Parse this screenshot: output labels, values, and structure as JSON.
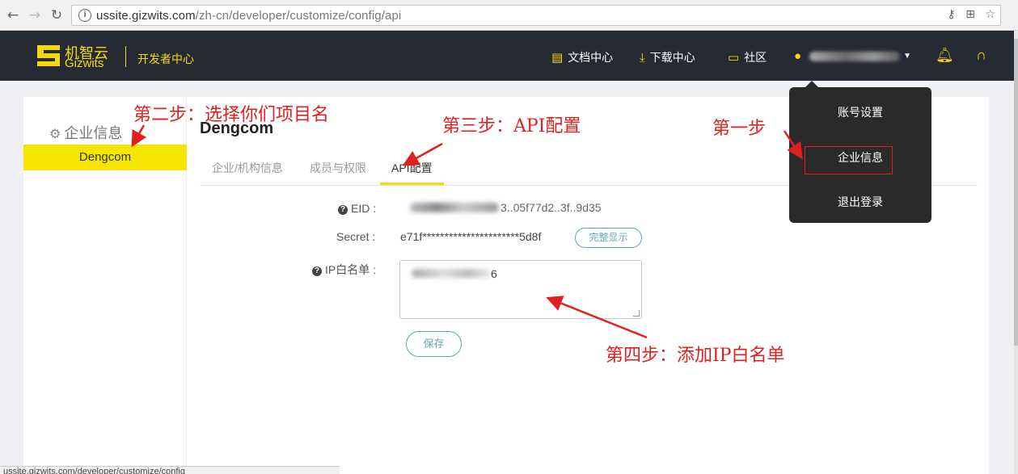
{
  "browser": {
    "url_host": "ussite.gizwits.com",
    "url_path": "/zh-cn/developer/customize/config/api",
    "status_url": "ussite.gizwits.com/developer/customize/config"
  },
  "header": {
    "brand_cn": "机智云",
    "brand_en": "Gizwits",
    "dev_center": "开发者中心",
    "nav": [
      {
        "label": "文档中心",
        "icon": "document-icon"
      },
      {
        "label": "下载中心",
        "icon": "download-icon"
      },
      {
        "label": "社区",
        "icon": "chat-icon"
      }
    ],
    "accent": "#f6d80f",
    "bg": "#262b33"
  },
  "sidebar": {
    "title": "企业信息",
    "items": [
      {
        "label": "Dengcom",
        "active": true
      }
    ]
  },
  "main": {
    "title": "Dengcom",
    "tabs": [
      {
        "label": "企业/机构信息"
      },
      {
        "label": "成员与权限"
      },
      {
        "label": "API配置",
        "active": true
      }
    ],
    "eid_label": "EID :",
    "eid_visible": "3..05f77d2..3f..9d35",
    "secret_label": "Secret :",
    "secret_value": "e71f**********************5d8f",
    "show_full_button": "完整显示",
    "ip_label": "IP白名单 :",
    "ip_visible": "6",
    "save_button": "保存"
  },
  "dropdown": {
    "items": [
      "账号设置",
      "企业信息",
      "退出登录"
    ]
  },
  "annotations": {
    "step1": "第一步",
    "step2": "第二步：选择你们项目名",
    "step3": "第三步：API配置",
    "step4": "第四步：添加IP白名单"
  }
}
